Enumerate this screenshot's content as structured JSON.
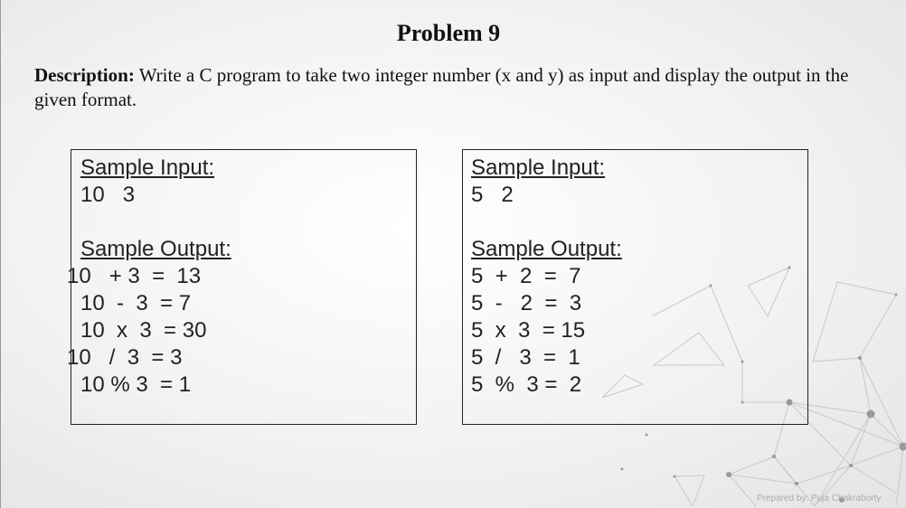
{
  "title": "Problem 9",
  "description": {
    "label": "Description:",
    "text": " Write a C program to take two integer number (x and y) as input and display the output in the given format."
  },
  "sample1": {
    "input_heading": "Sample Input:",
    "input_value": "10   3",
    "output_heading": "Sample Output:",
    "outputs": [
      "10   + 3  =  13",
      "10  -  3  = 7",
      "10  x  3  = 30",
      "10   /  3  = 3",
      "10 % 3  = 1"
    ]
  },
  "sample2": {
    "input_heading": "Sample Input:",
    "input_value": "5   2",
    "output_heading": "Sample Output:",
    "outputs": [
      "5  +  2  =  7",
      "5  -   2  =  3",
      "5  x  3  = 15",
      "5  /   3  =  1",
      "5  %  3 =  2"
    ]
  },
  "footer": "Prepared by: Puja Chakraborty"
}
